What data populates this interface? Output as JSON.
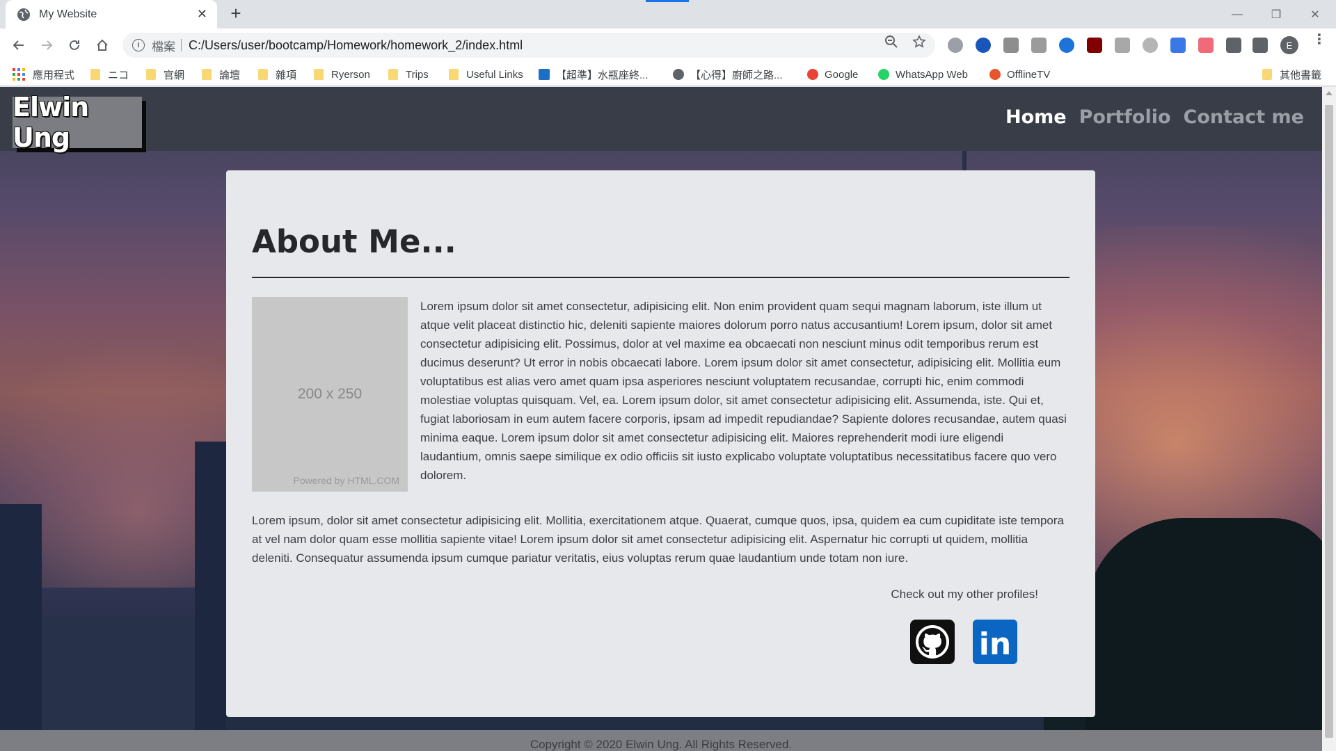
{
  "browser": {
    "tab_title": "My Website",
    "url_scheme_label": "檔案",
    "url": "C:/Users/user/bootcamp/Homework/homework_2/index.html",
    "profile_initial": "E",
    "icons": [
      "back-icon",
      "forward-icon",
      "reload-icon",
      "home-icon",
      "info-icon",
      "zoom-icon",
      "star-icon",
      "extensions-icon",
      "menu-icon"
    ]
  },
  "bookmarks": {
    "apps_label": "應用程式",
    "items": [
      "ニコ",
      "官網",
      "論壇",
      "雜項",
      "Ryerson",
      "Trips",
      "Useful Links",
      "【超準】水瓶座終...",
      "【心得】廚師之路...",
      "Google",
      "WhatsApp Web",
      "OfflineTV"
    ],
    "other_label": "其他書籤"
  },
  "site": {
    "logo": "Elwin Ung",
    "nav": [
      "Home",
      "Portfolio",
      "Contact me"
    ],
    "heading": "About Me...",
    "image_placeholder": {
      "size_label": "200 x 250",
      "powered_by": "Powered by HTML.COM"
    },
    "para1": "Lorem ipsum dolor sit amet consectetur, adipisicing elit. Non enim provident quam sequi magnam laborum, iste illum ut atque velit placeat distinctio hic, deleniti sapiente maiores dolorum porro natus accusantium! Lorem ipsum, dolor sit amet consectetur adipisicing elit. Possimus, dolor at vel maxime ea obcaecati non nesciunt minus odit temporibus rerum est ducimus deserunt? Ut error in nobis obcaecati labore. Lorem ipsum dolor sit amet consectetur, adipisicing elit. Mollitia eum voluptatibus est alias vero amet quam ipsa asperiores nesciunt voluptatem recusandae, corrupti hic, enim commodi molestiae voluptas quisquam. Vel, ea. Lorem ipsum dolor, sit amet consectetur adipisicing elit. Assumenda, iste. Qui et, fugiat laboriosam in eum autem facere corporis, ipsam ad impedit repudiandae? Sapiente dolores recusandae, autem quasi minima eaque. Lorem ipsum dolor sit amet consectetur adipisicing elit. Maiores reprehenderit modi iure eligendi laudantium, omnis saepe similique ex odio officiis sit iusto explicabo voluptate voluptatibus necessitatibus facere quo vero dolorem.",
    "para2": "Lorem ipsum, dolor sit amet consectetur adipisicing elit. Mollitia, exercitationem atque. Quaerat, cumque quos, ipsa, quidem ea cum cupiditate iste tempora at vel nam dolor quam esse mollitia sapiente vitae! Lorem ipsum dolor sit amet consectetur adipisicing elit. Aspernatur hic corrupti ut quidem, mollitia deleniti. Consequatur assumenda ipsum cumque pariatur veritatis, eius voluptas rerum quae laudantium unde totam non iure.",
    "profiles_text": "Check out my other profiles!",
    "social": [
      "github-icon",
      "linkedin-icon"
    ],
    "linkedin_text": "in",
    "footer": "Copyright © 2020 Elwin Ung. All Rights Reserved."
  },
  "colors": {
    "header_bg": "#383d47",
    "card_bg": "#e6e8ec",
    "nav_active": "#ffffff",
    "nav_inactive": "#9a9ea6",
    "linkedin_blue": "#0a66c2"
  }
}
